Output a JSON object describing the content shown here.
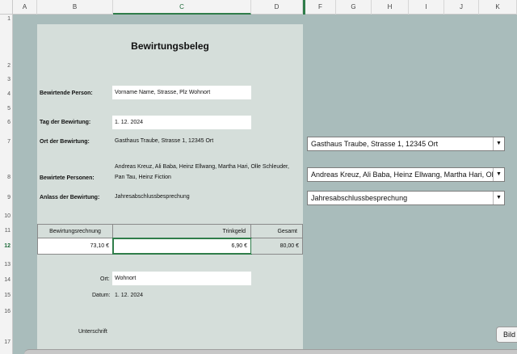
{
  "columns": [
    "A",
    "B",
    "C",
    "D",
    "",
    "F",
    "G",
    "H",
    "I",
    "J",
    "K"
  ],
  "selected_column": "C",
  "rows": [
    "1",
    "2",
    "3",
    "4",
    "5",
    "6",
    "7",
    "8",
    "9",
    "10",
    "11",
    "12",
    "13",
    "14",
    "15",
    "16",
    "17"
  ],
  "selected_row": "12",
  "doc": {
    "title": "Bewirtungsbeleg",
    "host_label": "Bewirtende Person:",
    "host_value": "Vorname Name, Strasse, Plz Wohnort",
    "date_label": "Tag der Bewirtung:",
    "date_value": "1. 12. 2024",
    "place_label": "Ort der Bewirtung:",
    "place_value": "Gasthaus Traube, Strasse 1, 12345 Ort",
    "guests_label": "Bewirtete Personen:",
    "guests_value_line1": "Andreas Kreuz, Ali Baba, Heinz Ellwang, Martha Hari, Olle Schleuder,",
    "guests_value_line2": "Pan Tau, Heinz Fiction",
    "occasion_label": "Anlass der Bewirtung:",
    "occasion_value": "Jahresabschlussbesprechung",
    "table": {
      "headers": [
        "Bewirtungsrechnung",
        "Trinkgeld",
        "Gesamt"
      ],
      "values": [
        "73,10 €",
        "6,90 €",
        "80,00 €"
      ]
    },
    "ort_label": "Ort:",
    "ort_value": "Wohnort",
    "datum_label": "Datum:",
    "datum_value": "1. 12. 2024",
    "signature_label": "Unterschrift"
  },
  "dropdowns": {
    "place": "Gasthaus Traube, Strasse 1, 12345 Ort",
    "guests": "Andreas Kreuz, Ali Baba, Heinz Ellwang, Martha Hari, Olle Schleuder",
    "occasion": "Jahresabschlussbesprechung"
  },
  "button_bild": "Bild"
}
